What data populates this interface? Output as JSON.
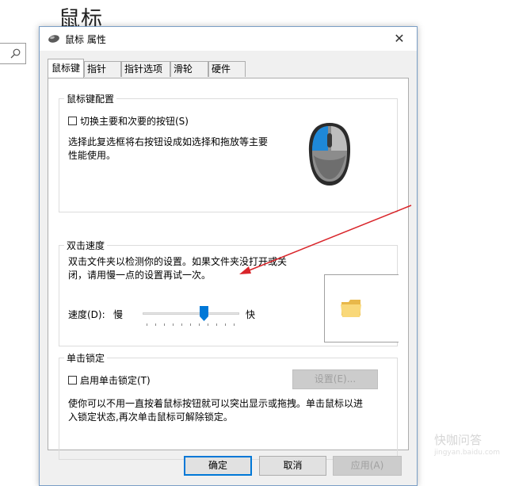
{
  "background": {
    "title": "鼠标"
  },
  "dialog": {
    "title": "鼠标 属性",
    "close_glyph": "✕",
    "tabs": [
      {
        "label": "鼠标键"
      },
      {
        "label": "指针"
      },
      {
        "label": "指针选项"
      },
      {
        "label": "滑轮"
      },
      {
        "label": "硬件"
      }
    ],
    "button_config": {
      "title": "鼠标键配置",
      "checkbox_label": "切换主要和次要的按钮(S)",
      "checked": false,
      "description_line1": "选择此复选框将右按钮设成如选择和拖放等主要",
      "description_line2": "性能使用。"
    },
    "double_click": {
      "title": "双击速度",
      "description_line1": "双击文件夹以检测你的设置。如果文件夹没打开或关",
      "description_line2": "闭，请用慢一点的设置再试一次。",
      "speed_label": "速度(D):",
      "slow_label": "慢",
      "fast_label": "快",
      "slider_value_fraction": 0.6
    },
    "click_lock": {
      "title": "单击锁定",
      "checkbox_label": "启用单击锁定(T)",
      "checked": false,
      "settings_button": "设置(E)...",
      "description_line1": "使你可以不用一直按着鼠标按钮就可以突出显示或拖拽。单击鼠标以进",
      "description_line2": "入锁定状态,再次单击鼠标可解除锁定。"
    },
    "buttons": {
      "ok": "确定",
      "cancel": "取消",
      "apply": "应用(A)"
    }
  },
  "colors": {
    "accent": "#0078d7",
    "annotation_arrow": "#d9252a",
    "mouse_highlight": "#1e88d8"
  },
  "watermark": {
    "brand": "快咖问答",
    "sub": "jingyan.baidu.com"
  }
}
